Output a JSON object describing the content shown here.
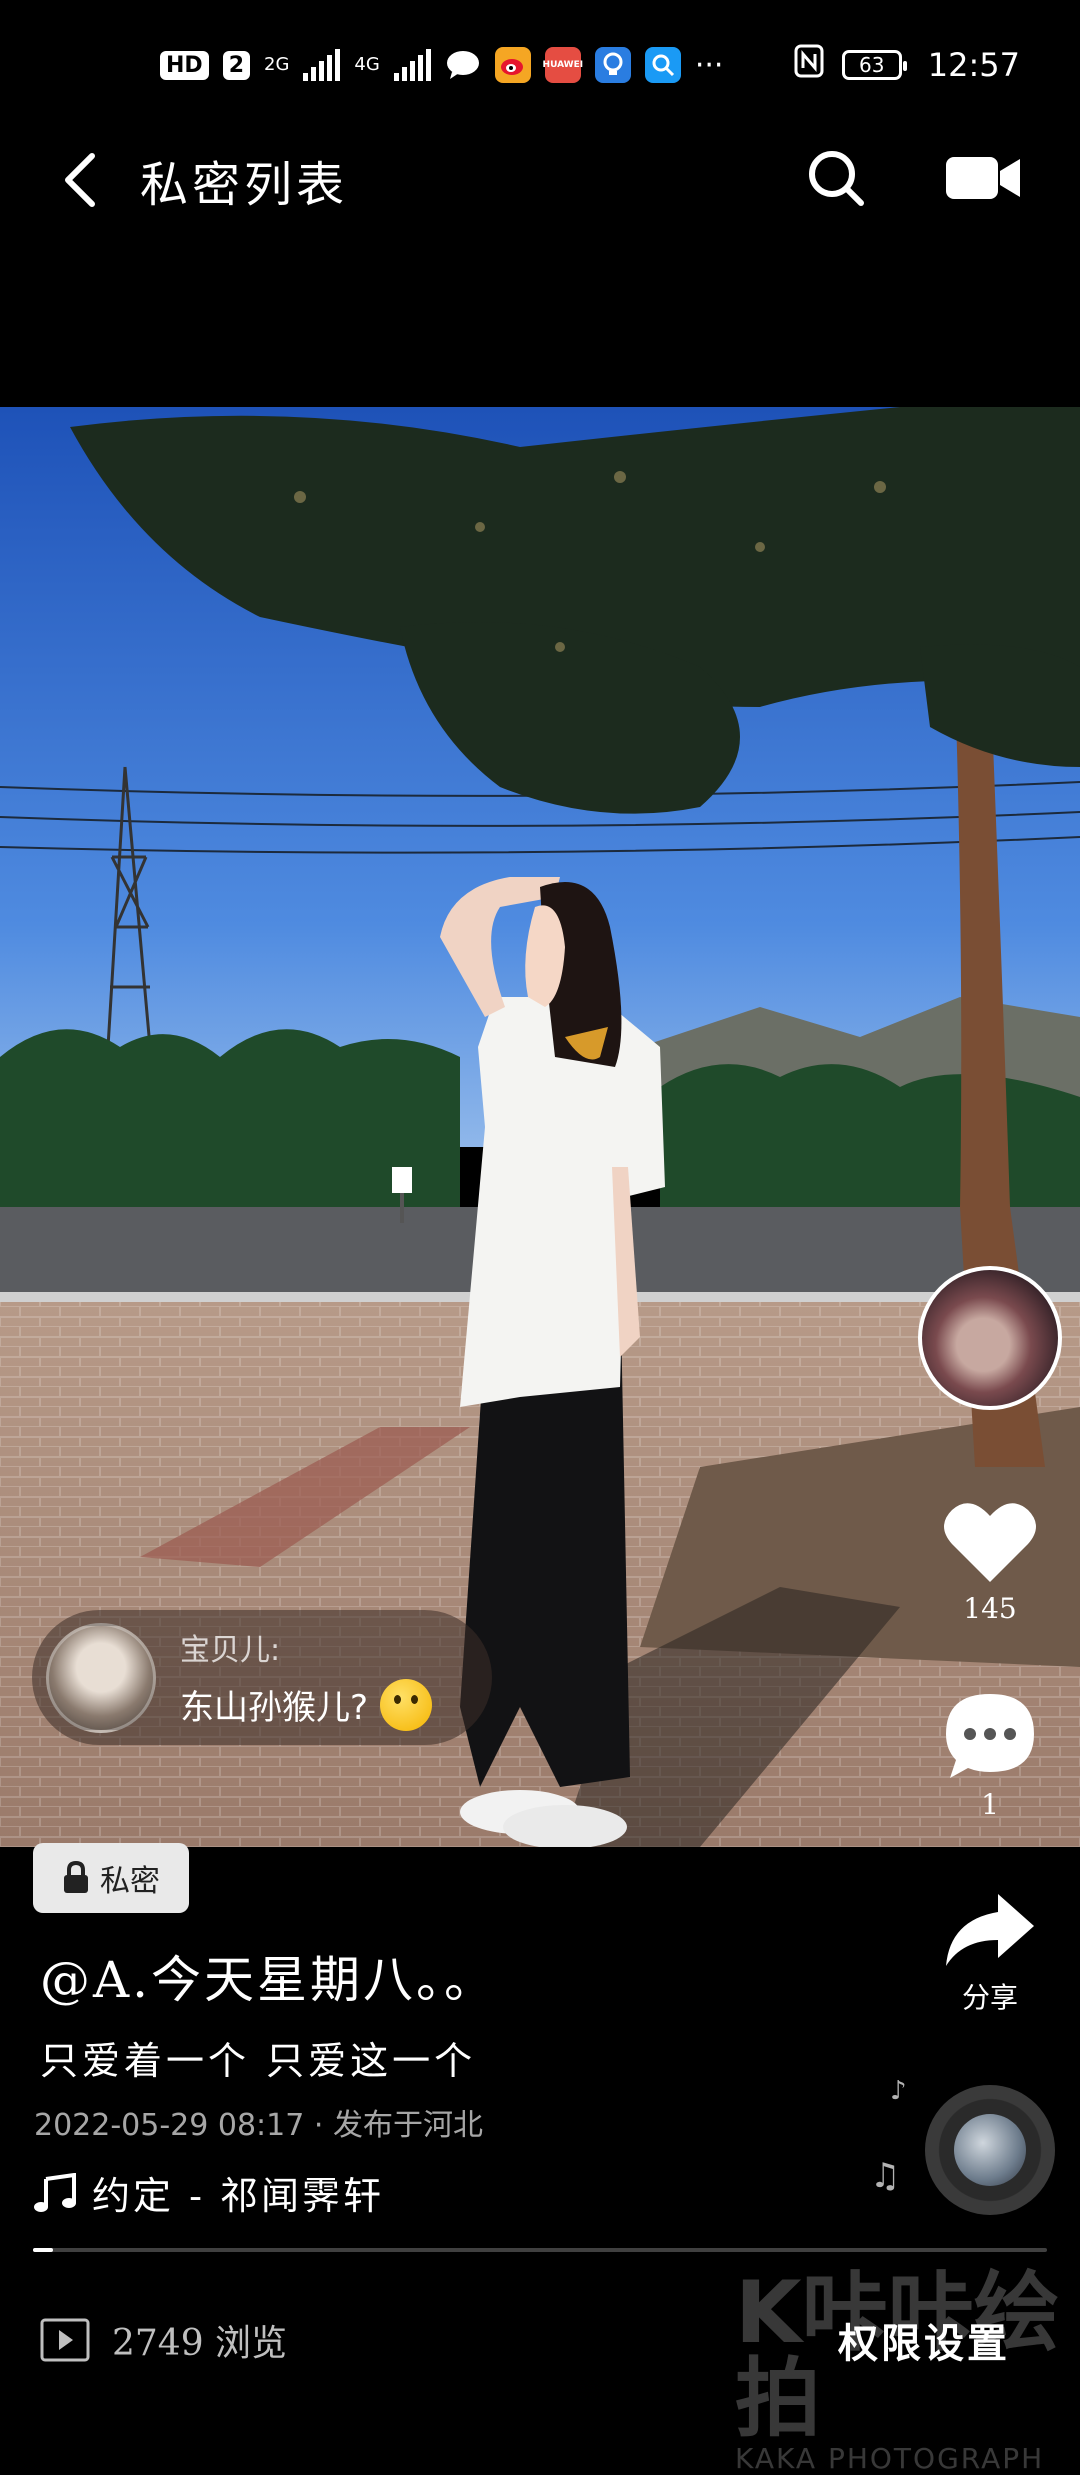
{
  "status_bar": {
    "hd": "HD",
    "sim": "2",
    "net1": "2G",
    "net2": "4G",
    "more": "···",
    "battery": "63",
    "time": "12:57",
    "apps": [
      "message-icon",
      "weibo-icon",
      "huawei-icon",
      "lightbulb-icon",
      "search-app-icon"
    ],
    "app_colors": [
      "#ffffff",
      "#f5a623",
      "#e54d42",
      "#2a7de1",
      "#1a9af5"
    ]
  },
  "header": {
    "title": "私密列表"
  },
  "comment": {
    "author": "宝贝儿:",
    "text": "东山孙猴儿?"
  },
  "rail": {
    "likes": "145",
    "comments": "1",
    "share": "分享"
  },
  "post": {
    "badge": "私密",
    "author": "@A.今天星期八。。",
    "caption": "只爱着一个 只爱这一个",
    "meta": "2022-05-29 08:17 · 发布于河北",
    "music": "约定 - 祁闻霁轩",
    "progress": 0.02
  },
  "bottom": {
    "views": "2749 浏览",
    "permission": "权限设置"
  },
  "watermark": {
    "top": "K咔咔绘拍",
    "bottom": "KAKA PHOTOGRAPH"
  }
}
